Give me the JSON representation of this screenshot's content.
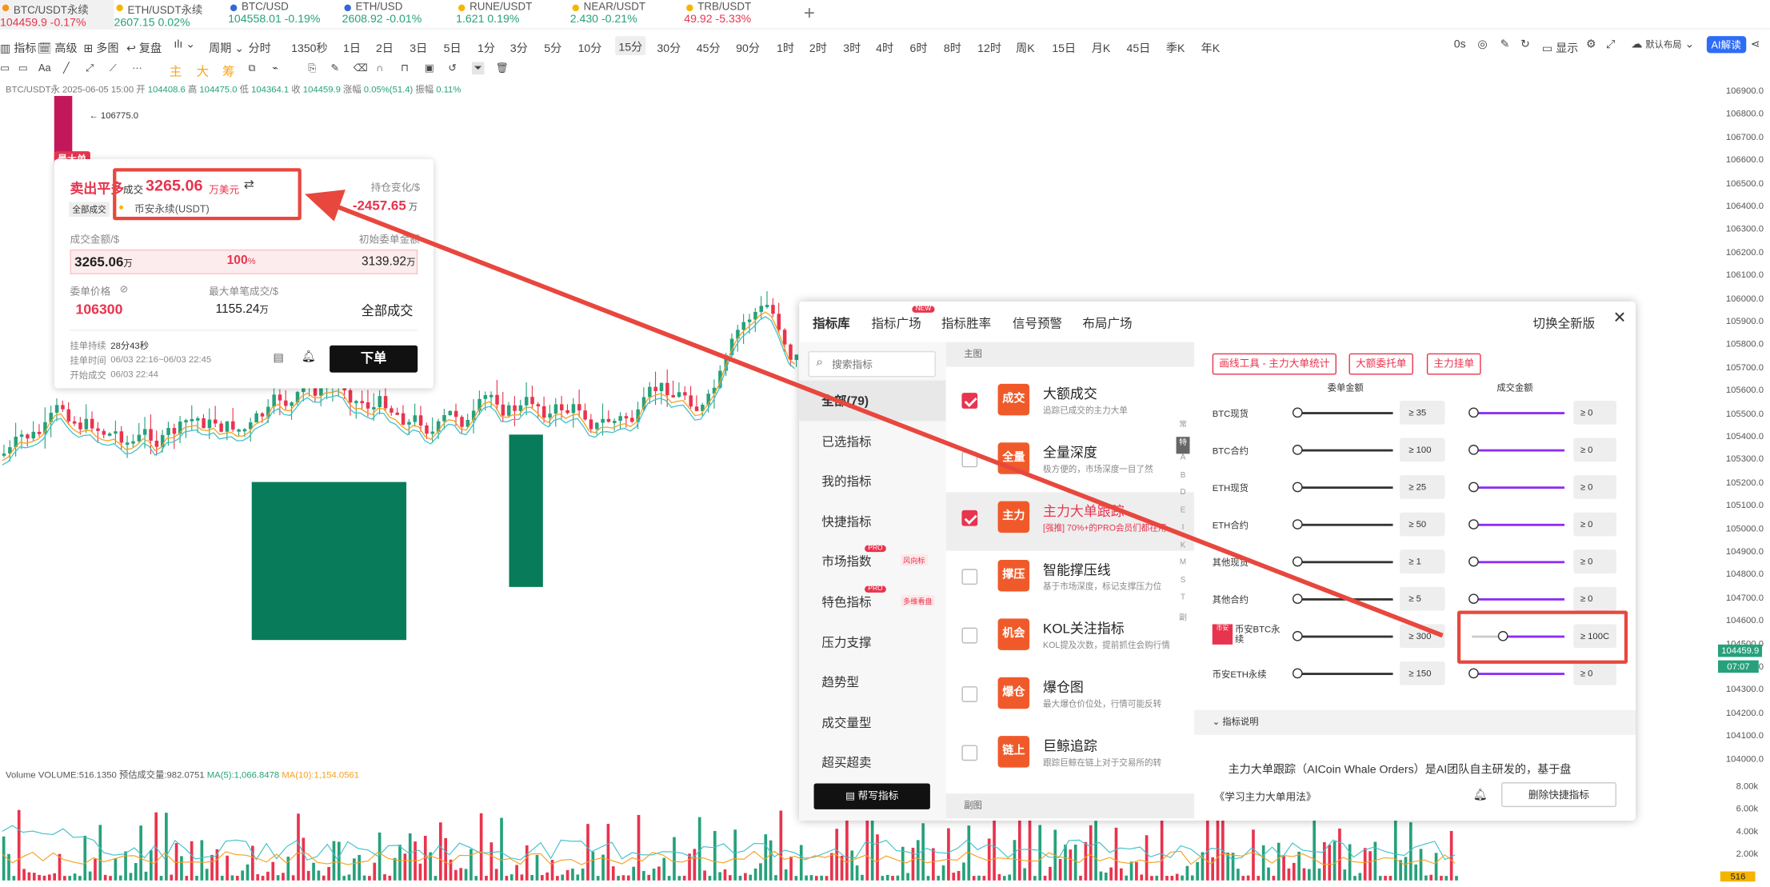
{
  "tickers": [
    {
      "pair": "BTC/USDT永续",
      "price": "104459.9",
      "chg": "-0.17%",
      "dot": "#f7931a",
      "dir": "dn"
    },
    {
      "pair": "ETH/USDT永续",
      "price": "2607.15",
      "chg": "0.02%",
      "dot": "#f7b500",
      "dir": "up"
    },
    {
      "pair": "BTC/USD",
      "price": "104558.01",
      "chg": "-0.19%",
      "dot": "#3467d8",
      "dir": "up"
    },
    {
      "pair": "ETH/USD",
      "price": "2608.92",
      "chg": "-0.01%",
      "dot": "#3467d8",
      "dir": "up"
    },
    {
      "pair": "RUNE/USDT",
      "price": "1.621",
      "chg": "0.19%",
      "dot": "#f7b500",
      "dir": "up"
    },
    {
      "pair": "NEAR/USDT",
      "price": "2.430",
      "chg": "-0.21%",
      "dot": "#f7b500",
      "dir": "up"
    },
    {
      "pair": "TRB/USDT",
      "price": "49.92",
      "chg": "-5.33%",
      "dot": "#f7b500",
      "dir": "dn"
    }
  ],
  "toolbar": {
    "indicator": "指标",
    "advanced": "高级",
    "multi": "多图",
    "review": "复盘",
    "period": "周期",
    "periods": [
      "分时",
      "1350秒",
      "1日",
      "2日",
      "3日",
      "5日",
      "1分",
      "3分",
      "5分",
      "10分",
      "15分",
      "30分",
      "45分",
      "90分",
      "1时",
      "2时",
      "3时",
      "4时",
      "6时",
      "8时",
      "12时",
      "周K",
      "15日",
      "月K",
      "45日",
      "季K",
      "年K"
    ],
    "active_period": "15分",
    "right_zero": "0s",
    "display": "显示",
    "layout": "默认布局",
    "ai": "AI解读"
  },
  "drawbar": {
    "text_tool": "Aa",
    "zhu": "主",
    "da": "大",
    "chou": "筹"
  },
  "ohlc": {
    "symbol": "BTC/USDT永",
    "time": "2025-06-05 15:00",
    "open_label": "开",
    "open": "104408.6",
    "high_label": "高",
    "high": "104475.0",
    "low_label": "低",
    "low": "104364.1",
    "close_label": "收",
    "close": "104459.9",
    "amp_label": "涨幅",
    "amp": "0.05%(51.4)",
    "range_label": "振幅",
    "range": "0.11%"
  },
  "chart": {
    "peak_label": "106775.0",
    "price_ticks": [
      "106900.0",
      "106800.0",
      "106700.0",
      "106600.0",
      "106500.0",
      "106400.0",
      "106300.0",
      "106200.0",
      "106100.0",
      "106000.0",
      "105900.0",
      "105800.0",
      "105700.0",
      "105600.0",
      "105500.0",
      "105400.0",
      "105300.0",
      "105200.0",
      "105100.0",
      "105000.0",
      "104900.0",
      "104800.0",
      "104700.0",
      "104600.0",
      "104500.0",
      "104400.0",
      "104300.0",
      "104200.0",
      "104100.0",
      "104000.0"
    ],
    "current_price": "104459.9",
    "countdown": "07:07",
    "vol_ticks": [
      "8.00k",
      "6.00k",
      "4.00k",
      "2.00k"
    ],
    "vol_current": "516",
    "volume_legend": {
      "label": "Volume",
      "vol": "VOLUME:516.1350",
      "est": "预估成交量:982.0751",
      "ma5": "MA(5):1,066.8478",
      "ma10": "MA(10):1,154.0561"
    },
    "colors": {
      "up": "#26a17b",
      "down": "#e8344e",
      "block": "#087c5a",
      "ma1": "#f4a020",
      "ma2": "#3fc0c9"
    }
  },
  "card": {
    "badge": "最大单",
    "side": "卖出平多",
    "deal_label": "成交",
    "deal_value": "3265.06",
    "deal_unit": "万美元",
    "tag": "全部成交",
    "exchange": "币安永续(USDT)",
    "pos_chg_label": "持仓变化/$",
    "pos_chg_value": "-2457.65",
    "pos_chg_unit": "万",
    "amt_label": "成交金额/$",
    "init_label": "初始委单金额",
    "amt_value": "3265.06",
    "amt_unit": "万",
    "pct_value": "100",
    "pct_unit": "%",
    "init_value": "3139.92",
    "init_unit": "万",
    "price_label": "委单价格",
    "max_label": "最大单笔成交/$",
    "price_value": "106300",
    "max_value": "1155.24",
    "max_unit": "万",
    "status": "全部成交",
    "dur_label": "挂单持续",
    "dur_value": "28分43秒",
    "time_label": "挂单时间",
    "time_value": "06/03 22:16~06/03 22:45",
    "start_label": "开始成交",
    "start_value": "06/03 22:44",
    "order_btn": "下单"
  },
  "panel": {
    "tabs": [
      {
        "label": "指标库",
        "active": true
      },
      {
        "label": "指标广场",
        "badge": "NEW"
      },
      {
        "label": "指标胜率"
      },
      {
        "label": "信号预警"
      },
      {
        "label": "布局广场"
      }
    ],
    "switch_label": "切换全新版",
    "search_placeholder": "搜索指标",
    "nav": [
      {
        "label": "全部(79)",
        "active": true
      },
      {
        "label": "已选指标"
      },
      {
        "label": "我的指标"
      },
      {
        "label": "快捷指标"
      },
      {
        "label": "市场指数",
        "badge": "PRO",
        "tag": "风向标"
      },
      {
        "label": "特色指标",
        "badge": "PRO",
        "tag": "多维看盘"
      },
      {
        "label": "压力支撑"
      },
      {
        "label": "趋势型"
      },
      {
        "label": "成交量型"
      },
      {
        "label": "超买超卖"
      }
    ],
    "write_btn": "帮写指标",
    "main_header": "主图",
    "sub_header": "副图",
    "indicators": [
      {
        "icon": "成交",
        "name": "大额成交",
        "desc": "追踪已成交的主力大单",
        "checked": true
      },
      {
        "icon": "全量",
        "name": "全量深度",
        "desc": "极方便的，市场深度一目了然",
        "checked": false
      },
      {
        "icon": "主力",
        "name": "主力大单跟踪",
        "desc": "[强推] 70%+的PRO会员们都在用",
        "checked": true,
        "selected": true
      },
      {
        "icon": "撑压",
        "name": "智能撑压线",
        "desc": "基于市场深度，标记支撑压力位",
        "checked": false
      },
      {
        "icon": "机会",
        "name": "KOL关注指标",
        "desc": "KOL提及次数，提前抓住会购行情",
        "checked": false
      },
      {
        "icon": "爆仓",
        "name": "爆仓图",
        "desc": "最大爆仓价位处，行情可能反转",
        "checked": false
      },
      {
        "icon": "链上",
        "name": "巨鲸追踪",
        "desc": "跟踪巨鲸在链上对于交易所的转",
        "checked": false
      }
    ],
    "alpha": [
      "常",
      "特",
      "A",
      "B",
      "D",
      "E",
      "I",
      "K",
      "M",
      "S",
      "T",
      "副"
    ],
    "btns": [
      "画线工具 - 主力大单统计",
      "大额委托单",
      "主力挂单"
    ],
    "col1": "委单金额",
    "col2": "成交金额",
    "rows": [
      {
        "label": "BTC现货",
        "v1": "≥  35",
        "v2": "≥   0"
      },
      {
        "label": "BTC合约",
        "v1": "≥  100",
        "v2": "≥   0"
      },
      {
        "label": "ETH现货",
        "v1": "≥  25",
        "v2": "≥   0"
      },
      {
        "label": "ETH合约",
        "v1": "≥  50",
        "v2": "≥   0"
      },
      {
        "label": "其他现货",
        "v1": "≥   1",
        "v2": "≥   0"
      },
      {
        "label": "其他合约",
        "v1": "≥   5",
        "v2": "≥   0"
      },
      {
        "label": "币安BTC永续",
        "v1": "≥  300",
        "v2": "≥ 100C",
        "tag": "币安"
      },
      {
        "label": "币安ETH永续",
        "v1": "≥  150",
        "v2": "≥   0"
      }
    ],
    "explain_label": "指标说明",
    "explain_text": "主力大单跟踪（AICoin Whale Orders）是AI团队自主研发的，基于盘",
    "learn_link": "《学习主力大单用法》",
    "delete_btn": "删除快捷指标"
  }
}
